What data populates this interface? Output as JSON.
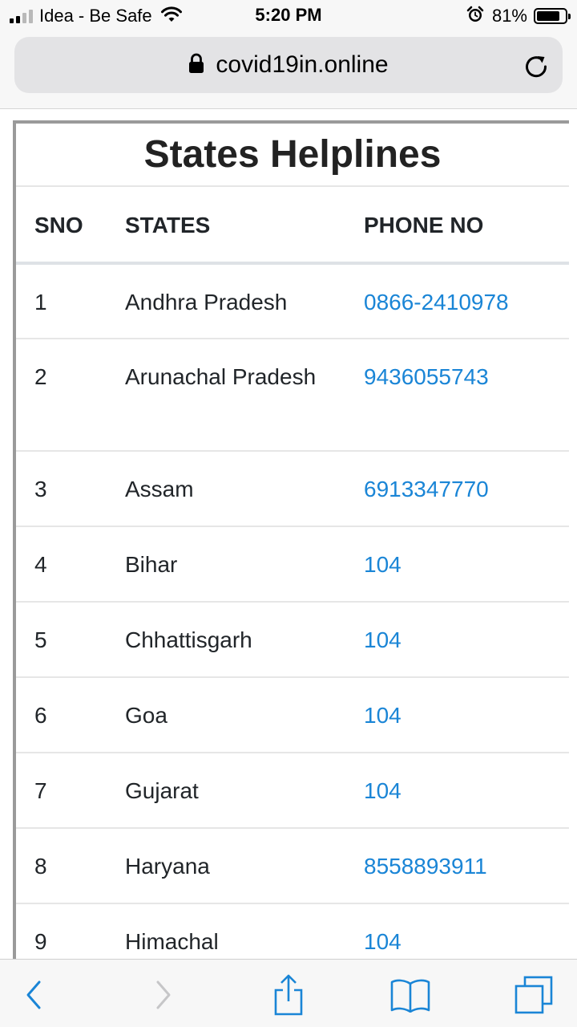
{
  "status_bar": {
    "carrier": "Idea - Be Safe",
    "time": "5:20 PM",
    "battery_percent": "81%",
    "battery_level": 0.81
  },
  "browser": {
    "url": "covid19in.online"
  },
  "page": {
    "title": "States Helplines",
    "columns": {
      "sno": "SNO",
      "state": "STATES",
      "phone": "PHONE NO"
    },
    "rows": [
      {
        "sno": "1",
        "state": "Andhra Pradesh",
        "phone": "0866-2410978"
      },
      {
        "sno": "2",
        "state": "Arunachal Pradesh",
        "phone": "9436055743"
      },
      {
        "sno": "3",
        "state": "Assam",
        "phone": "6913347770"
      },
      {
        "sno": "4",
        "state": "Bihar",
        "phone": "104"
      },
      {
        "sno": "5",
        "state": "Chhattisgarh",
        "phone": "104"
      },
      {
        "sno": "6",
        "state": "Goa",
        "phone": "104"
      },
      {
        "sno": "7",
        "state": "Gujarat",
        "phone": "104"
      },
      {
        "sno": "8",
        "state": "Haryana",
        "phone": "8558893911"
      },
      {
        "sno": "9",
        "state": "Himachal",
        "phone": "104"
      }
    ]
  },
  "colors": {
    "link": "#1a85d6",
    "toolbar_icon": "#1a85d6",
    "toolbar_icon_disabled": "#c6c6c8"
  },
  "toolbar": {
    "icons": [
      "back-icon",
      "forward-icon",
      "share-icon",
      "bookmarks-icon",
      "tabs-icon"
    ]
  }
}
